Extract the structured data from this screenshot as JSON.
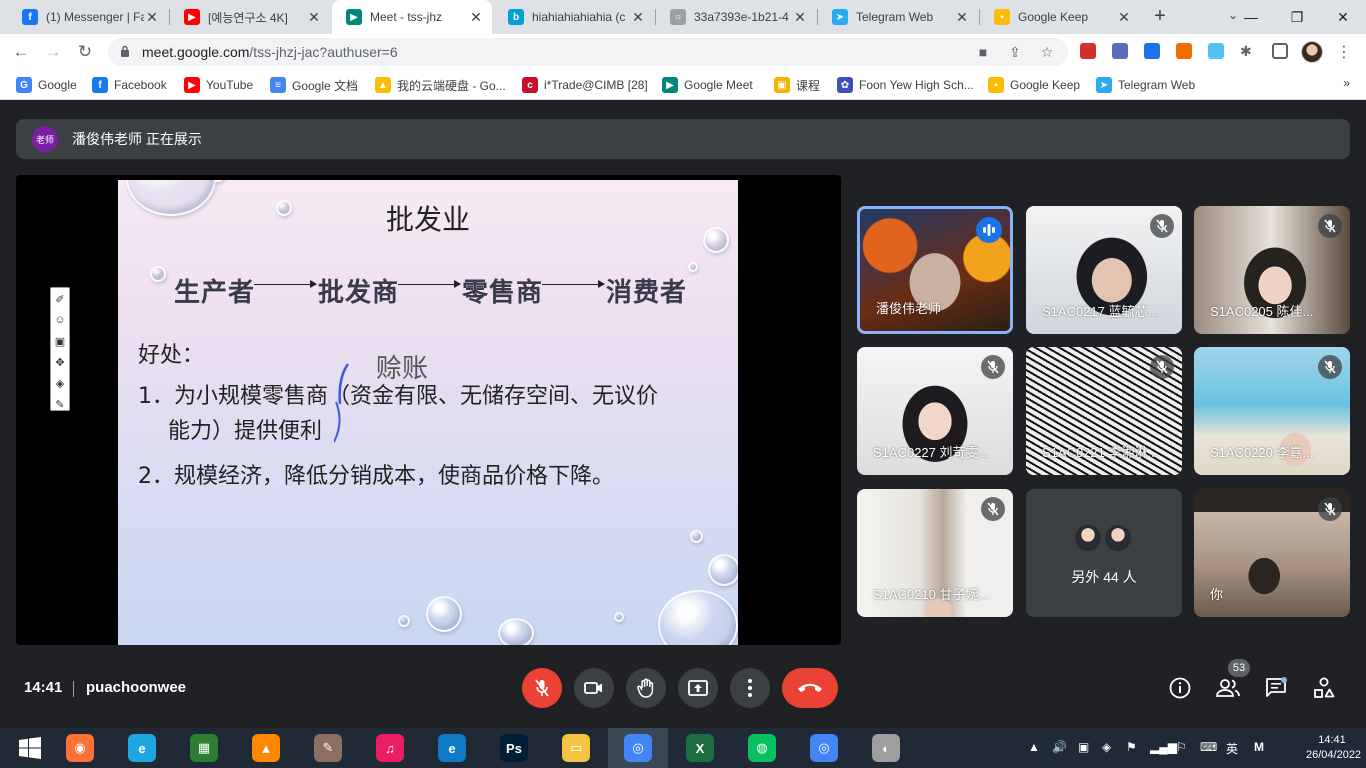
{
  "browser": {
    "tabs": [
      {
        "title": "(1) Messenger | Fa",
        "icon": "facebook-icon",
        "color": "#1877f2",
        "glyph": "f"
      },
      {
        "title": "[예능연구소 4K] ",
        "icon": "youtube-icon",
        "color": "#ff0000",
        "glyph": "▶"
      },
      {
        "title": "Meet - tss-jhz",
        "icon": "google-meet-icon",
        "color": "#00897b",
        "glyph": "▶",
        "active": true
      },
      {
        "title": "hiahiahiahiahia (c",
        "icon": "bilibili-icon",
        "color": "#00a1d6",
        "glyph": "b"
      },
      {
        "title": "33a7393e-1b21-4",
        "icon": "loading-icon",
        "color": "#9aa0a6",
        "glyph": "○"
      },
      {
        "title": "Telegram Web",
        "icon": "telegram-icon",
        "color": "#2aabee",
        "glyph": "➤"
      },
      {
        "title": "Google Keep",
        "icon": "google-keep-icon",
        "color": "#fbbc04",
        "glyph": "▪"
      }
    ],
    "new_tab": "+",
    "url_host": "meet.google.com",
    "url_path": "/tss-jhzj-jac?authuser=6"
  },
  "bookmarks": [
    {
      "label": "Google",
      "icon": "google-icon",
      "color": "#4285f4",
      "glyph": "G"
    },
    {
      "label": "Facebook",
      "icon": "facebook-icon",
      "color": "#1877f2",
      "glyph": "f"
    },
    {
      "label": "YouTube",
      "icon": "youtube-icon",
      "color": "#ff0000",
      "glyph": "▶"
    },
    {
      "label": "Google 文档",
      "icon": "google-docs-icon",
      "color": "#4285f4",
      "glyph": "≡"
    },
    {
      "label": "我的云端硬盘 - Go...",
      "icon": "google-drive-icon",
      "color": "#fbbc04",
      "glyph": "▲"
    },
    {
      "label": "i*Trade@CIMB [28]",
      "icon": "cimb-icon",
      "color": "#c8102e",
      "glyph": "c"
    },
    {
      "label": "Google Meet",
      "icon": "google-meet-icon",
      "color": "#00897b",
      "glyph": "▶"
    },
    {
      "label": "课程",
      "icon": "classroom-icon",
      "color": "#f4b400",
      "glyph": "▣"
    },
    {
      "label": "Foon Yew High Sch...",
      "icon": "school-icon",
      "color": "#3f51b5",
      "glyph": "✿"
    },
    {
      "label": "Google Keep",
      "icon": "google-keep-icon",
      "color": "#fbbc04",
      "glyph": "▪"
    },
    {
      "label": "Telegram Web",
      "icon": "telegram-icon",
      "color": "#2aabee",
      "glyph": "➤"
    }
  ],
  "bookmarks_more": "»",
  "meet": {
    "presenting_badge": "老师",
    "presenting_text": "潘俊伟老师 正在展示",
    "slide": {
      "title": "批发业",
      "chain": [
        "生产者",
        "批发商",
        "零售商",
        "消费者"
      ],
      "benefits_heading": "好处：",
      "handwritten": "赊账",
      "point1_line1": "1．为小规模零售商（资金有限、无储存空间、无议价",
      "point1_line2": "能力）提供便利",
      "point2": "2．规模经济，降低分销成本，使商品价格下降。"
    },
    "participants": [
      {
        "name": "潘俊伟老师",
        "state": "speaking"
      },
      {
        "name": "S1AC0217 蓝毓芯...",
        "state": "muted"
      },
      {
        "name": "S1AC0205 陈佳...",
        "state": "muted"
      },
      {
        "name": "S1AC0227 刘苛雯...",
        "state": "muted"
      },
      {
        "name": "S1AC0221 李湘淋...",
        "state": "muted"
      },
      {
        "name": "S1AC0220 李嘉...",
        "state": "muted"
      },
      {
        "name": "S1AC0210 甘子婉...",
        "state": "muted"
      },
      {
        "name": "另外 44 人",
        "state": "others"
      },
      {
        "name": "你",
        "state": "muted"
      }
    ],
    "time": "14:41",
    "meeting_name": "puachoonwee",
    "people_count": "53",
    "colors": {
      "accent": "#8ab4f8",
      "end_call": "#ea4335",
      "speaking": "#1a73e8"
    }
  },
  "taskbar": {
    "apps": [
      {
        "name": "firefox-icon",
        "color": "#ff7139",
        "glyph": "◉"
      },
      {
        "name": "internet-explorer-icon",
        "color": "#1ea7e1",
        "glyph": "e"
      },
      {
        "name": "store-icon",
        "color": "#2e7d32",
        "glyph": "▦"
      },
      {
        "name": "vlc-icon",
        "color": "#ff8800",
        "glyph": "▲"
      },
      {
        "name": "paint-icon",
        "color": "#8d6e63",
        "glyph": "✎"
      },
      {
        "name": "itunes-icon",
        "color": "#e91e63",
        "glyph": "♫"
      },
      {
        "name": "edge-icon",
        "color": "#0f7bc4",
        "glyph": "e"
      },
      {
        "name": "photoshop-icon",
        "color": "#001e36",
        "glyph": "Ps"
      },
      {
        "name": "file-explorer-icon",
        "color": "#f4c542",
        "glyph": "▭"
      },
      {
        "name": "chrome-icon",
        "color": "#4285f4",
        "glyph": "◎",
        "active": true
      },
      {
        "name": "excel-icon",
        "color": "#1d6f42",
        "glyph": "X"
      },
      {
        "name": "wechat-icon",
        "color": "#07c160",
        "glyph": "◍"
      },
      {
        "name": "chrome-icon",
        "color": "#4285f4",
        "glyph": "◎"
      },
      {
        "name": "speaker-app-icon",
        "color": "#9e9e9e",
        "glyph": "◐"
      }
    ],
    "ime": "英",
    "clock_time": "14:41",
    "clock_date": "26/04/2022"
  }
}
